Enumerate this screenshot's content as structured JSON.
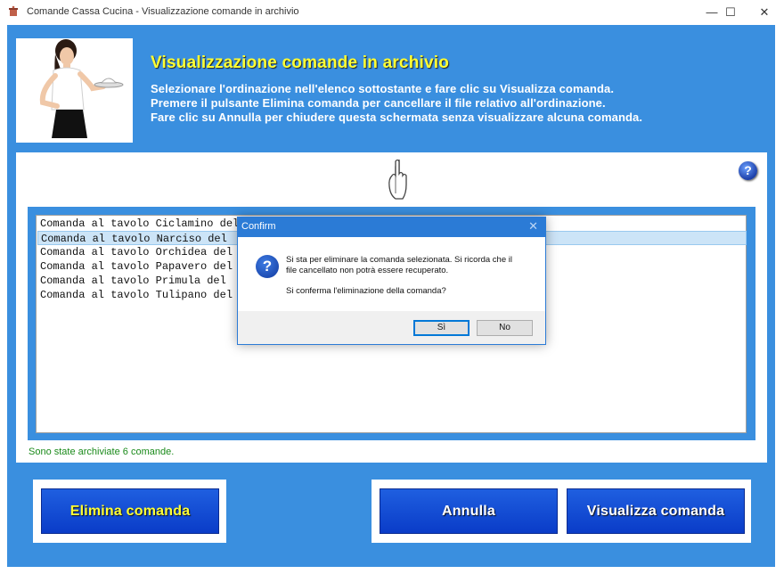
{
  "window": {
    "title": "Comande Cassa Cucina - Visualizzazione comande in archivio",
    "minimize_glyph": "—",
    "maximize_glyph": "☐",
    "close_glyph": "✕"
  },
  "header": {
    "title": "Visualizzazione comande in archivio",
    "lines": [
      "Selezionare l'ordinazione nell'elenco sottostante e fare clic su Visualizza comanda.",
      "Premere il pulsante Elimina comanda per cancellare il file relativo all'ordinazione.",
      "Fare clic su Annulla per chiudere questa schermata senza visualizzare alcuna comanda."
    ],
    "help_glyph": "?"
  },
  "orders": [
    "Comanda al tavolo Ciclamino del",
    "Comanda al tavolo Narciso del",
    "Comanda al tavolo Orchidea del",
    "Comanda al tavolo Papavero del",
    "Comanda al tavolo Primula del",
    "Comanda al tavolo Tulipano del"
  ],
  "selected_index": 1,
  "status": "Sono state archiviate 6 comande.",
  "buttons": {
    "delete": "Elimina comanda",
    "cancel": "Annulla",
    "view": "Visualizza comanda"
  },
  "colors": {
    "frame_blue": "#3a8fdf",
    "header_title": "#ffff33",
    "delete_label": "#ffff33",
    "button_label": "#ffffff",
    "status_green": "#1a8a1a"
  },
  "dialog": {
    "title": "Confirm",
    "close_glyph": "✕",
    "icon_glyph": "?",
    "message_line1": "Si sta per eliminare la comanda selezionata. Si ricorda che il",
    "message_line2": "file cancellato non potrà essere recuperato.",
    "question": "Si conferma l'eliminazione della comanda?",
    "yes": "Sì",
    "no": "No"
  }
}
